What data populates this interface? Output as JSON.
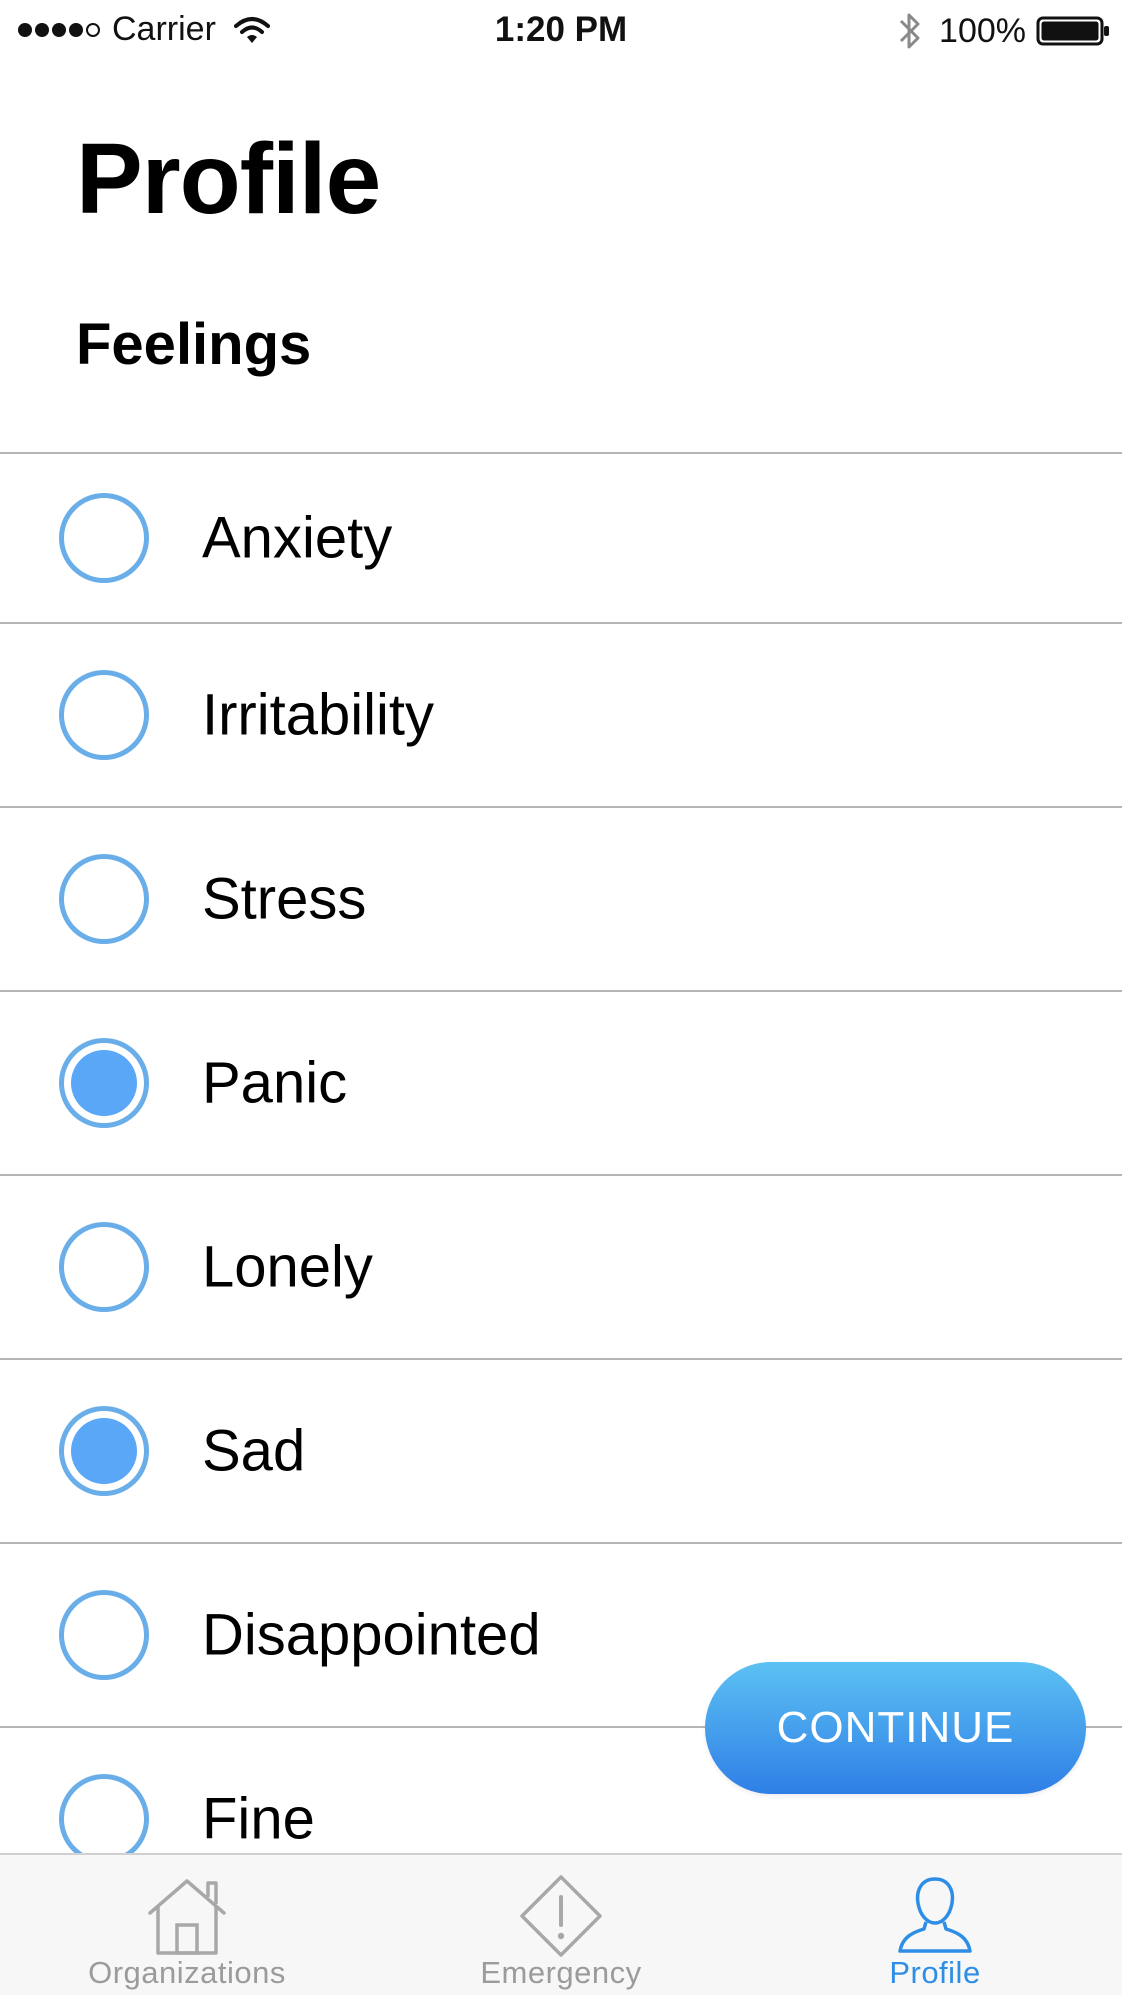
{
  "status_bar": {
    "carrier": "Carrier",
    "time": "1:20 PM",
    "battery": "100%"
  },
  "header": {
    "title": "Profile",
    "section": "Feelings"
  },
  "feelings": [
    {
      "label": "Anxiety",
      "checked": false
    },
    {
      "label": "Irritability",
      "checked": false
    },
    {
      "label": "Stress",
      "checked": false
    },
    {
      "label": "Panic",
      "checked": true
    },
    {
      "label": "Lonely",
      "checked": false
    },
    {
      "label": "Sad",
      "checked": true
    },
    {
      "label": "Disappointed",
      "checked": false
    },
    {
      "label": "Fine",
      "checked": false
    }
  ],
  "continue_button": {
    "label": "CONTINUE"
  },
  "tab_bar": {
    "tabs": [
      {
        "label": "Organizations",
        "icon": "house-icon",
        "active": false
      },
      {
        "label": "Emergency",
        "icon": "warning-icon",
        "active": false
      },
      {
        "label": "Profile",
        "icon": "person-icon",
        "active": true
      }
    ]
  },
  "colors": {
    "accent": "#2e8ee6",
    "radio_border": "#6aaee9",
    "radio_fill": "#5aa6f7",
    "button_gradient_top": "#5cc1f3",
    "button_gradient_bottom": "#2f7fe6",
    "tab_inactive": "#9b9b9b"
  }
}
